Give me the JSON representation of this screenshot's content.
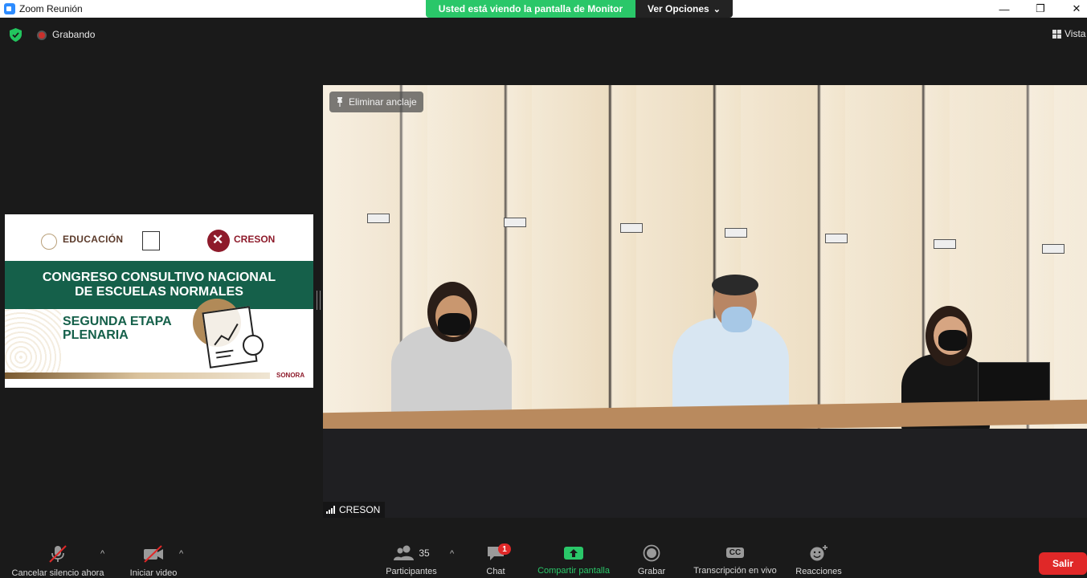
{
  "window": {
    "title": "Zoom Reunión",
    "minimize": "—",
    "maximize": "❐",
    "close": "✕"
  },
  "share_banner": {
    "status": "Usted está viendo la pantalla de Monitor",
    "options_label": "Ver Opciones",
    "options_caret": "⌄"
  },
  "meeting_bar": {
    "recording_label": "Grabando",
    "view_label": "Vista"
  },
  "thumbnail": {
    "logo_education": "EDUCACIÓN",
    "logo_creson": "CRESON",
    "headline_line1": "CONGRESO CONSULTIVO NACIONAL",
    "headline_line2": "DE ESCUELAS NORMALES",
    "sub_line1": "SEGUNDA ETAPA",
    "sub_line2": "PLENARIA",
    "logo_sonora": "SONORA"
  },
  "main_video": {
    "unpin_label": "Eliminar anclaje",
    "participant_name": "CRESON"
  },
  "toolbar": {
    "mute_label": "Cancelar silencio ahora",
    "video_label": "Iniciar video",
    "participants_label": "Participantes",
    "participants_count": "35",
    "chat_label": "Chat",
    "chat_badge": "1",
    "share_label": "Compartir pantalla",
    "record_label": "Grabar",
    "transcription_label": "Transcripción en vivo",
    "cc_text": "CC",
    "reactions_label": "Reacciones",
    "caret": "^",
    "leave_label": "Salir"
  },
  "colors": {
    "share_green": "#2ac769",
    "leave_red": "#e02828",
    "thumb_green": "#15604a"
  }
}
